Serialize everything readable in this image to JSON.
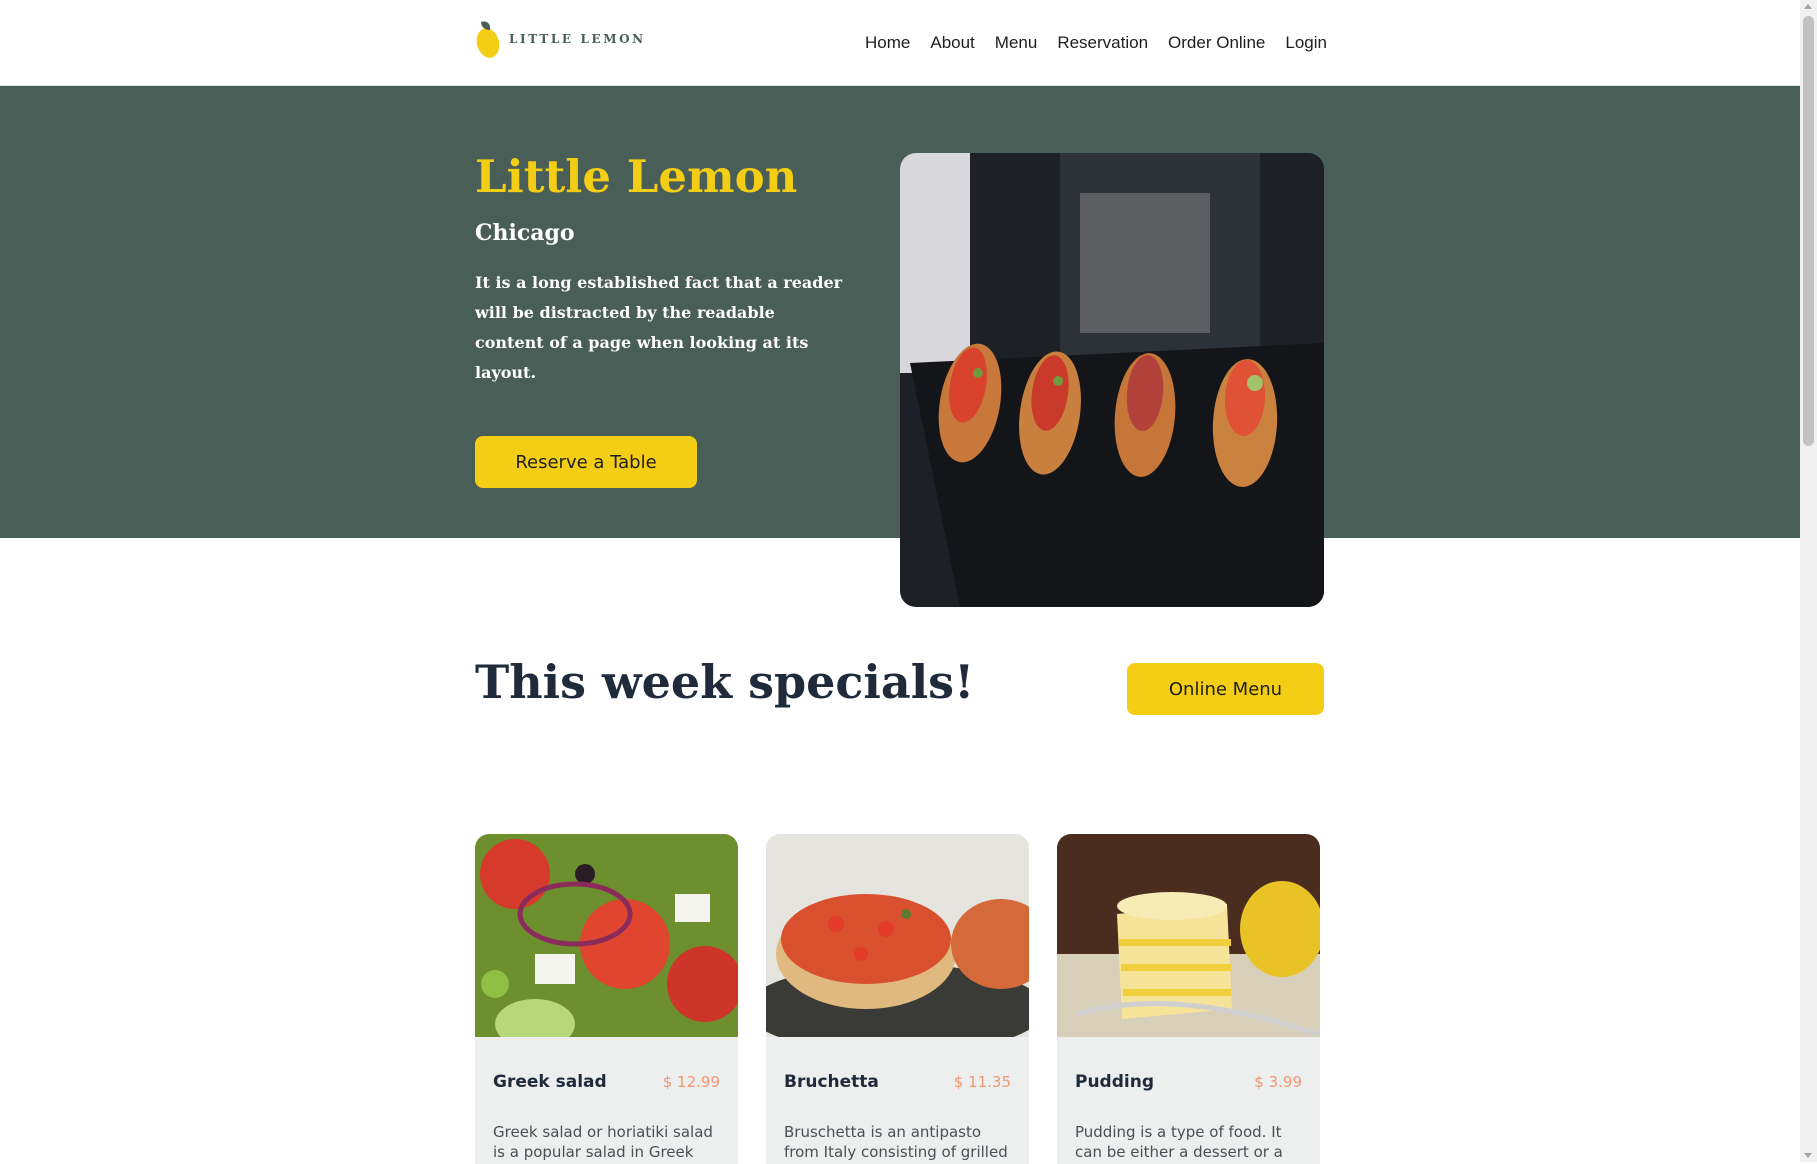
{
  "nav": {
    "logo_text": "LITTLE LEMON",
    "links": [
      "Home",
      "About",
      "Menu",
      "Reservation",
      "Order Online",
      "Login"
    ]
  },
  "hero": {
    "title": "Little Lemon",
    "subtitle": "Chicago",
    "description": "It is a long established fact that a reader will be distracted by the readable content of a page when looking at its layout.",
    "button_label": "Reserve a Table"
  },
  "specials": {
    "title": "This week specials!",
    "button_label": "Online Menu",
    "cards": [
      {
        "name": "Greek salad",
        "price": "$ 12.99",
        "description": "Greek salad or horiatiki salad is a popular salad in Greek"
      },
      {
        "name": "Bruchetta",
        "price": "$ 11.35",
        "description": "Bruschetta is an antipasto from Italy consisting of grilled"
      },
      {
        "name": "Pudding",
        "price": "$ 3.99",
        "description": "Pudding is a type of food. It can be either a dessert or a"
      }
    ]
  },
  "colors": {
    "primary_green": "#495e57",
    "primary_yellow": "#f4ce14",
    "price_orange": "#ee9972",
    "card_bg": "#edefee"
  }
}
